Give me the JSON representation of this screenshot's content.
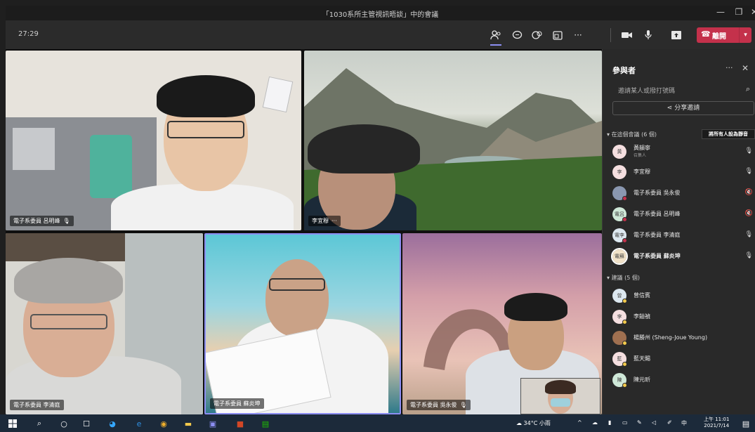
{
  "window": {
    "title": "「1030系所主管視訊晤談」中的會議",
    "minimize": "—",
    "maximize": "❐",
    "close": "✕"
  },
  "toolbar": {
    "timer": "27:29",
    "more": "···",
    "leave_label": "離開"
  },
  "tiles": [
    {
      "name": "電子系委員 呂明峰",
      "mic": "🎙"
    },
    {
      "name": "李宜穆",
      "extra": "···"
    },
    {
      "name": "電子系委員 李清庭",
      "mic": ""
    },
    {
      "name": "電子系委員 蘇炎坤",
      "mic": ""
    },
    {
      "name": "電子系委員 吳永俊",
      "mic": "🎙"
    }
  ],
  "sidebar": {
    "title": "參與者",
    "more": "···",
    "close": "✕",
    "search_placeholder": "邀請某人或撥打號碼",
    "share_invite": "分享邀請",
    "in_meeting_header": "在這個會議 (6 個)",
    "mute_all": "將所有人設為靜音",
    "in_meeting": [
      {
        "name": "黃韻寧",
        "sub": "召集人",
        "avatar": "黃",
        "avatar_color": "#f5dfe0",
        "mic": "🎙"
      },
      {
        "name": "李宜穆",
        "sub": "",
        "avatar": "李",
        "avatar_color": "#f5dfe0",
        "mic": "🎙"
      },
      {
        "name": "電子系委員 吳永俊",
        "sub": "",
        "avatar": "",
        "avatar_color": "#8a97b0",
        "mic": "🔇"
      },
      {
        "name": "電子系委員 呂明峰",
        "sub": "",
        "avatar": "電呂",
        "avatar_color": "#cfe8d8",
        "mic": "🔇"
      },
      {
        "name": "電子系委員 李清庭",
        "sub": "",
        "avatar": "電李",
        "avatar_color": "#dde8f0",
        "mic": "🎙"
      },
      {
        "name": "電子系委員 蘇炎坤",
        "sub": "",
        "avatar": "電蘇",
        "avatar_color": "#f1e2c8",
        "mic": "🎙"
      }
    ],
    "suggested_header": "建議 (5 個)",
    "suggested": [
      {
        "name": "曾信賓",
        "avatar": "曾",
        "avatar_color": "#dde8f0"
      },
      {
        "name": "李鎰禎",
        "avatar": "李",
        "avatar_color": "#f5dfe0"
      },
      {
        "name": "楊勝州 (Sheng-Joue Young)",
        "avatar": "",
        "avatar_color": "#a07050"
      },
      {
        "name": "藍天賜",
        "avatar": "藍",
        "avatar_color": "#f5dfe0"
      },
      {
        "name": "陳元昕",
        "avatar": "陳",
        "avatar_color": "#cfe8d8"
      }
    ]
  },
  "taskbar": {
    "weather": "34°C 小雨",
    "ime": "中",
    "time": "上午 11:01",
    "date": "2021/7/14"
  }
}
